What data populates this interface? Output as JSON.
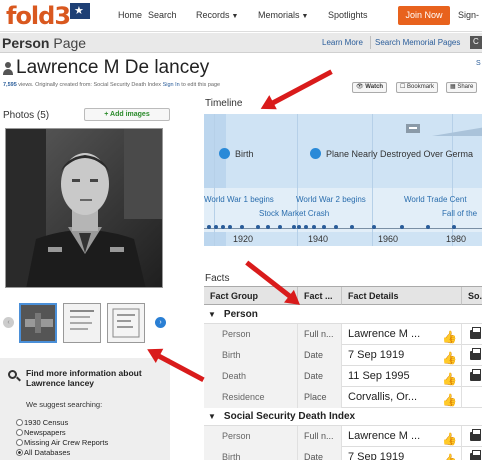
{
  "nav": {
    "logo_text": "fold3",
    "items": [
      {
        "label": "Home",
        "has_caret": false
      },
      {
        "label": "Search",
        "has_caret": false
      },
      {
        "label": "Records",
        "has_caret": true
      },
      {
        "label": "Memorials",
        "has_caret": true
      },
      {
        "label": "Spotlights",
        "has_caret": false
      }
    ],
    "join_label": "Join Now",
    "sign_label": "Sign-"
  },
  "pagebar": {
    "title_bold": "Person",
    "title_rest": " Page",
    "learn_more": "Learn More",
    "search_memorial": "Search Memorial Pages",
    "extra": "C"
  },
  "person": {
    "name": "Lawrence M De lancey",
    "views_line_start": "7,595",
    "views_line_mid": " views. Originally created from: Social Security Death Index ",
    "sign_in": "Sign In",
    "views_line_end": " to edit this page",
    "corner_letter": "S",
    "buttons": [
      "Watch",
      "Bookmark",
      "Share"
    ]
  },
  "photos": {
    "title": "Photos (5)",
    "add_label": "Add images"
  },
  "find_more": {
    "title": "Find more information about Lawrence lancey",
    "suggest": "We suggest searching:",
    "options": [
      {
        "label": "1930 Census",
        "selected": false
      },
      {
        "label": "Newspapers",
        "selected": false
      },
      {
        "label": "Missing Air Crew Reports",
        "selected": false
      },
      {
        "label": "All Databases",
        "selected": true
      }
    ]
  },
  "timeline": {
    "title": "Timeline",
    "events": [
      {
        "label": "Birth"
      },
      {
        "label": "Plane Nearly Destroyed Over Germa"
      }
    ],
    "minor_events": [
      "World War 1 begins",
      "World War 2 begins",
      "World Trade Cent",
      "Stock Market Crash",
      "Fall of the"
    ],
    "years": [
      "1920",
      "1940",
      "1960",
      "1980"
    ]
  },
  "facts": {
    "title": "Facts",
    "headers": [
      "Fact Group",
      "Fact ...",
      "Fact Details",
      "So..."
    ],
    "groups": [
      {
        "name": "Person",
        "rows": [
          {
            "group": "Person",
            "type": "Full n...",
            "detail": "Lawrence M ..."
          },
          {
            "group": "Birth",
            "type": "Date",
            "detail": "7 Sep 1919"
          },
          {
            "group": "Death",
            "type": "Date",
            "detail": "11 Sep 1995"
          },
          {
            "group": "Residence",
            "type": "Place",
            "detail": "Corvallis, Or..."
          }
        ]
      },
      {
        "name": "Social Security Death Index",
        "rows": [
          {
            "group": "Person",
            "type": "Full n...",
            "detail": "Lawrence M ..."
          },
          {
            "group": "Birth",
            "type": "Date",
            "detail": "7 Sep 1919"
          }
        ]
      }
    ]
  },
  "colors": {
    "brand_orange": "#e8621d",
    "link_blue": "#2a5d9a",
    "timeline_blue": "#2a8ad8",
    "annotation_red": "#d91b1b"
  }
}
